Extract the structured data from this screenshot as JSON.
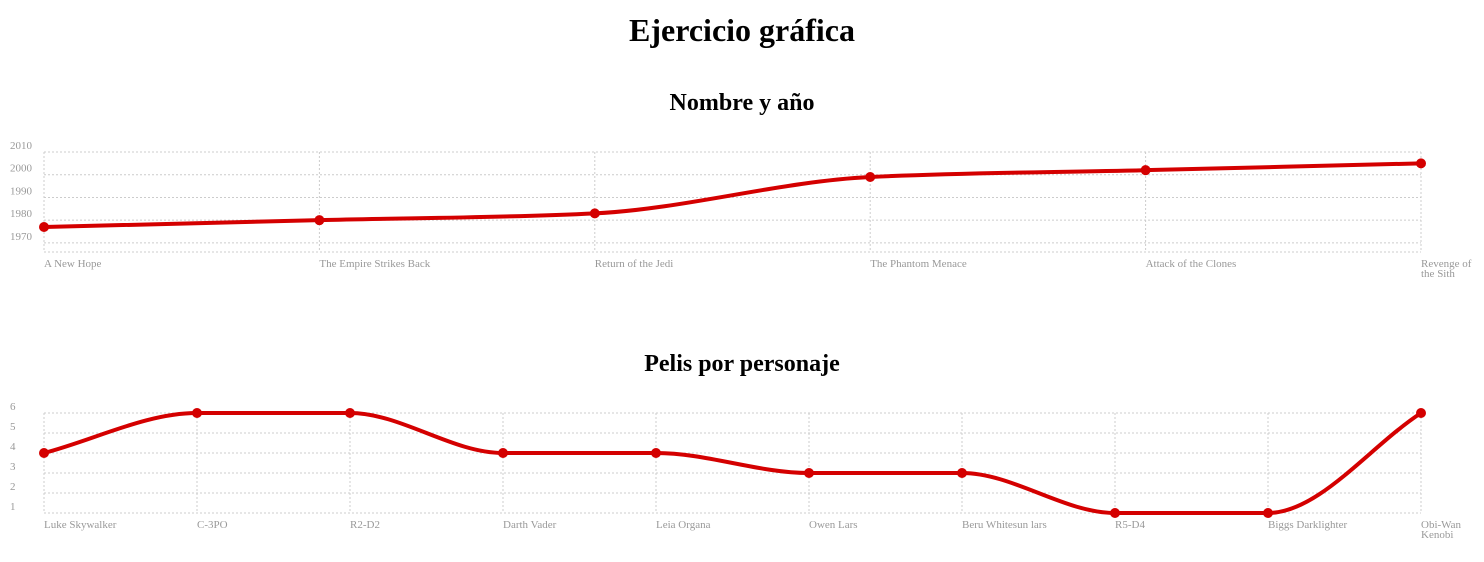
{
  "page": {
    "title": "Ejercicio gráfica"
  },
  "charts": {
    "accent": "#d40000",
    "chart_data": [
      {
        "type": "line",
        "title": "Nombre y año",
        "categories": [
          "A New Hope",
          "The Empire Strikes Back",
          "Return of the Jedi",
          "The Phantom Menace",
          "Attack of the Clones",
          "Revenge of the Sith"
        ],
        "values": [
          1977,
          1980,
          1983,
          1999,
          2002,
          2005
        ],
        "ylim": [
          1966,
          2010
        ],
        "yticks": [
          1970,
          1980,
          1990,
          2000,
          2010
        ],
        "grid": true,
        "color": "#d40000"
      },
      {
        "type": "line",
        "title": "Pelis por personaje",
        "categories": [
          "Luke Skywalker",
          "C-3PO",
          "R2-D2",
          "Darth Vader",
          "Leia Organa",
          "Owen Lars",
          "Beru Whitesun lars",
          "R5-D4",
          "Biggs Darklighter",
          "Obi-Wan Kenobi"
        ],
        "values": [
          4,
          6,
          6,
          4,
          4,
          3,
          3,
          1,
          1,
          6
        ],
        "ylim": [
          1,
          6
        ],
        "yticks": [
          1,
          2,
          3,
          4,
          5,
          6
        ],
        "grid": true,
        "color": "#d40000"
      }
    ]
  }
}
